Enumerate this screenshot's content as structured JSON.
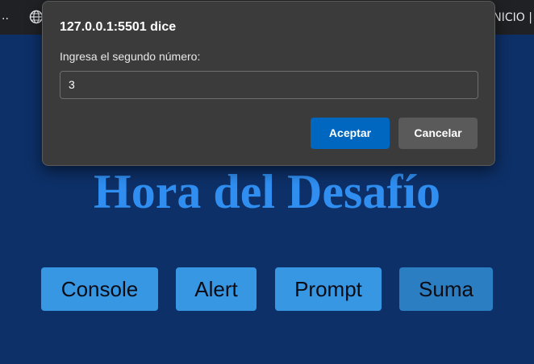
{
  "browser": {
    "overflow_label": "..",
    "bookmark_label": "INICIO |",
    "icon": "globe-icon"
  },
  "page": {
    "title": "Hora del Desafío",
    "buttons": [
      {
        "label": "Console"
      },
      {
        "label": "Alert"
      },
      {
        "label": "Prompt"
      },
      {
        "label": "Suma"
      }
    ]
  },
  "dialog": {
    "title": "127.0.0.1:5501 dice",
    "message": "Ingresa el segundo número:",
    "input_value": "3",
    "accept_label": "Aceptar",
    "cancel_label": "Cancelar"
  },
  "colors": {
    "page_background": "#0d3068",
    "title": "#2f8ef0",
    "button": "#3797e3",
    "button_hover": "#2c7ec2",
    "dialog_background": "#3b3b3b",
    "accept": "#0067c0",
    "cancel": "#5a5a5a"
  }
}
